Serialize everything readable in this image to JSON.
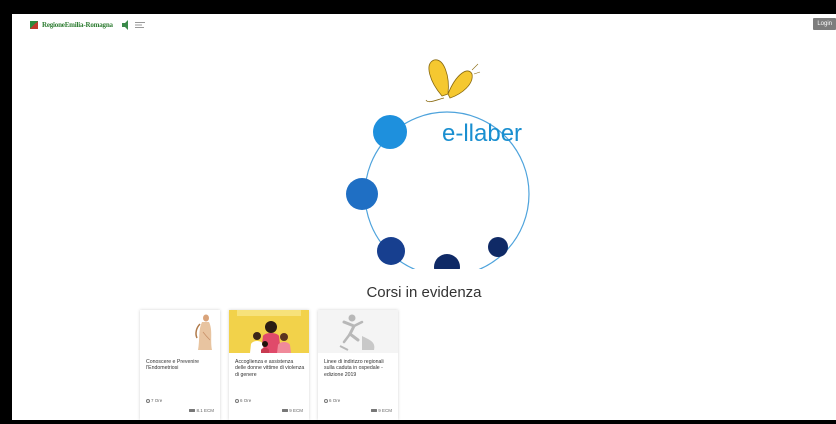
{
  "header": {
    "brand_label": "RegioneEmilia-Romagna",
    "login_label": "Login"
  },
  "logo": {
    "wordmark": "e-llaber",
    "colors": {
      "butterfly": "#f5c830",
      "ring": "#4ea3dc",
      "text": "#1a8fd0",
      "dot_light": "#1e90dd",
      "dot_mid": "#1f6fc4",
      "dot_dark": "#173f8f",
      "dot_navy": "#0f2a66"
    }
  },
  "section": {
    "title": "Corsi in evidenza"
  },
  "courses": [
    {
      "title": "Conoscere e Prevenire l'Endometriosi",
      "duration": "7 Ore",
      "credits": "8.1 ECM",
      "image_icon": "venus-painting-icon"
    },
    {
      "title": "Accoglienza e assistenza delle donne vittime di violenza di genere",
      "duration": "6 Ore",
      "credits": "9 ECM",
      "image_icon": "women-illustration-icon"
    },
    {
      "title": "Linee di indirizzo regionali sulla caduta in ospedale - edizione 2019",
      "duration": "6 Ore",
      "credits": "9 ECM",
      "image_icon": "falling-person-icon"
    }
  ]
}
